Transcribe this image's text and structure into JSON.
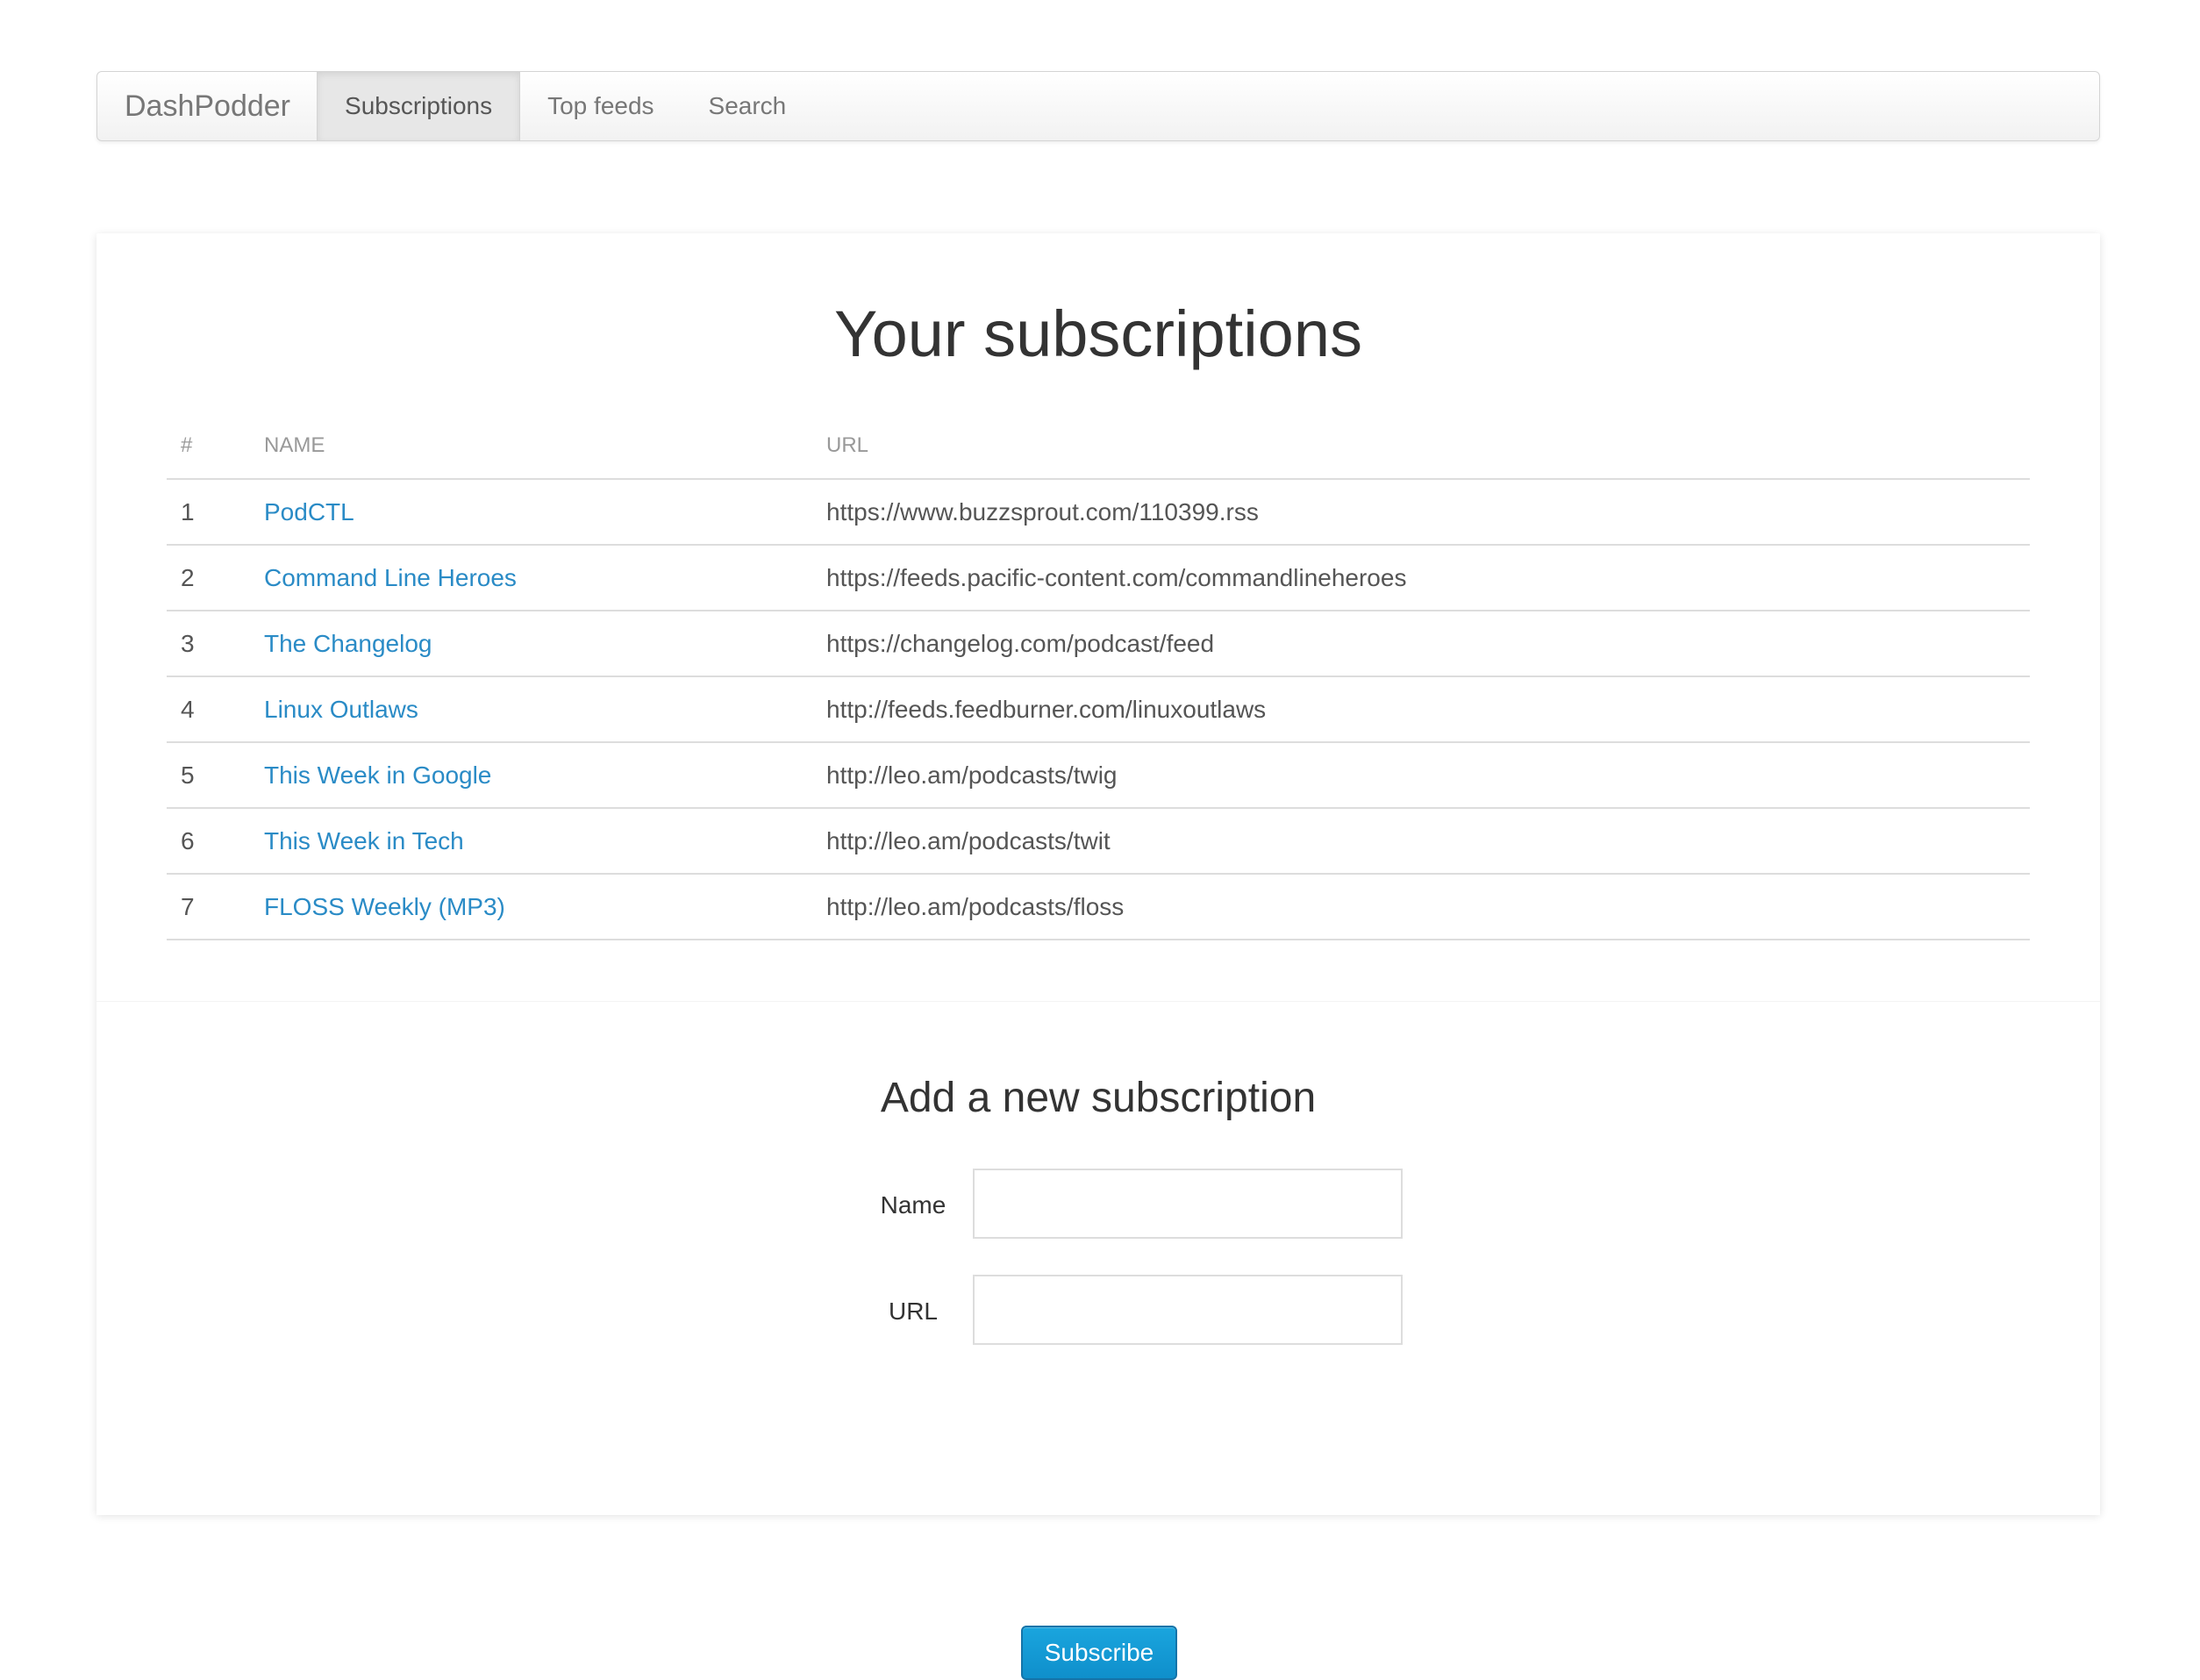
{
  "navbar": {
    "brand": "DashPodder",
    "items": [
      {
        "label": "Subscriptions",
        "active": true
      },
      {
        "label": "Top feeds",
        "active": false
      },
      {
        "label": "Search",
        "active": false
      }
    ]
  },
  "subscriptions": {
    "title": "Your subscriptions",
    "columns": {
      "num": "#",
      "name": "NAME",
      "url": "URL"
    },
    "rows": [
      {
        "num": "1",
        "name": "PodCTL",
        "url": "https://www.buzzsprout.com/110399.rss"
      },
      {
        "num": "2",
        "name": "Command Line Heroes",
        "url": "https://feeds.pacific-content.com/commandlineheroes"
      },
      {
        "num": "3",
        "name": "The Changelog",
        "url": "https://changelog.com/podcast/feed"
      },
      {
        "num": "4",
        "name": "Linux Outlaws",
        "url": "http://feeds.feedburner.com/linuxoutlaws"
      },
      {
        "num": "5",
        "name": "This Week in Google",
        "url": "http://leo.am/podcasts/twig"
      },
      {
        "num": "6",
        "name": "This Week in Tech",
        "url": "http://leo.am/podcasts/twit"
      },
      {
        "num": "7",
        "name": "FLOSS Weekly (MP3)",
        "url": "http://leo.am/podcasts/floss"
      }
    ]
  },
  "add_form": {
    "title": "Add a new subscription",
    "name_label": "Name",
    "name_value": "",
    "url_label": "URL",
    "url_value": "",
    "submit_label": "Subscribe"
  },
  "colors": {
    "link": "#2a8bc6",
    "button": "#1aa5de"
  }
}
